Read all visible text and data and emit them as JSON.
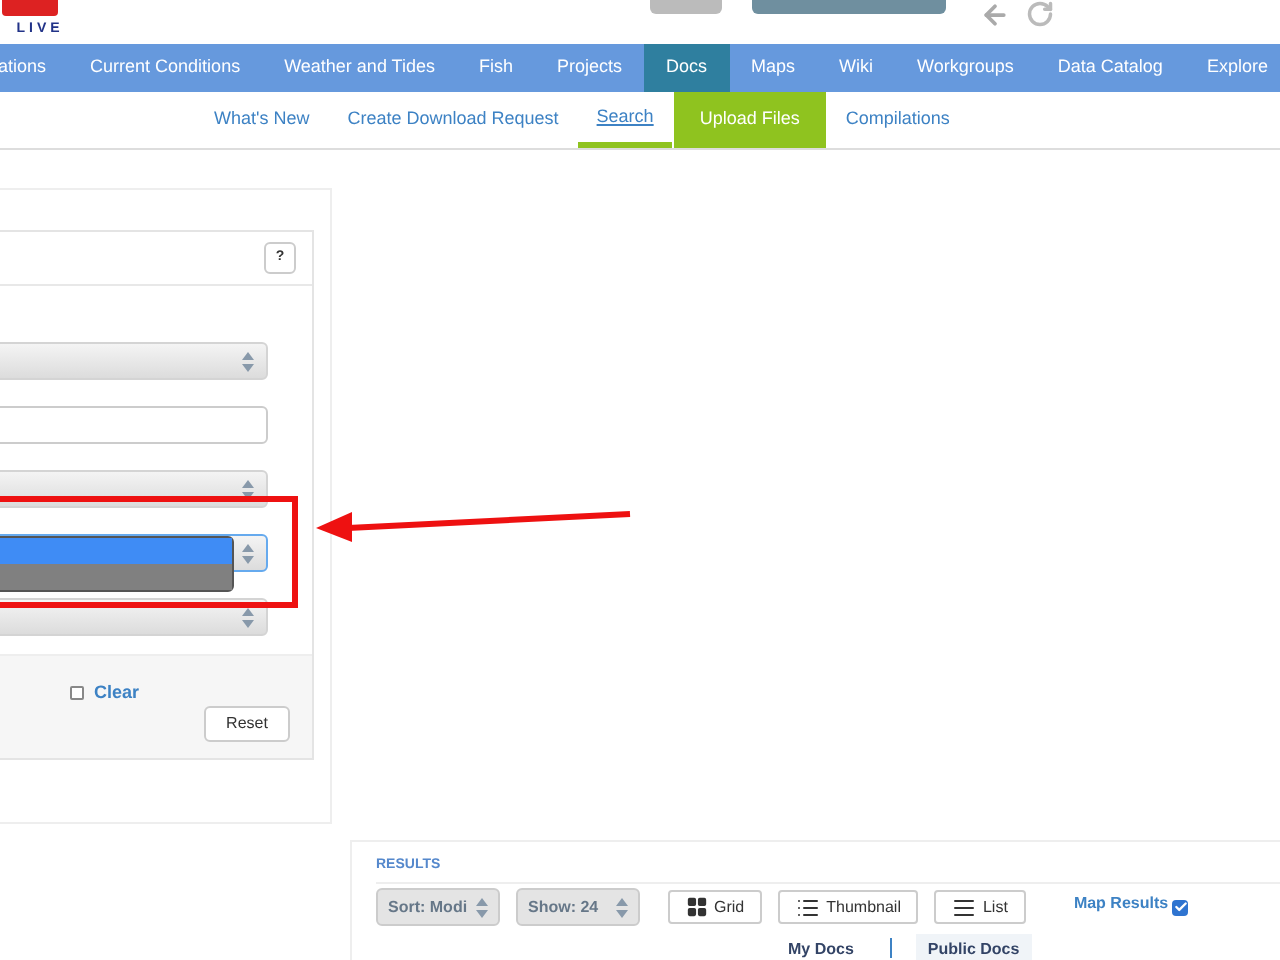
{
  "header": {
    "logo_text": "LIVE"
  },
  "nav": {
    "items": [
      {
        "label": "ations",
        "selected": false
      },
      {
        "label": "Current Conditions",
        "selected": false
      },
      {
        "label": "Weather and Tides",
        "selected": false
      },
      {
        "label": "Fish",
        "selected": false
      },
      {
        "label": "Projects",
        "selected": false
      },
      {
        "label": "Docs",
        "selected": true
      },
      {
        "label": "Maps",
        "selected": false
      },
      {
        "label": "Wiki",
        "selected": false
      },
      {
        "label": "Workgroups",
        "selected": false
      },
      {
        "label": "Data Catalog",
        "selected": false
      },
      {
        "label": "Explore",
        "selected": false
      }
    ]
  },
  "subnav": {
    "items": [
      {
        "label": "What's New",
        "selected": false,
        "kind": "link"
      },
      {
        "label": "Create Download Request",
        "selected": false,
        "kind": "link"
      },
      {
        "label": "Search",
        "selected": true,
        "kind": "link"
      },
      {
        "label": "Upload Files",
        "selected": false,
        "kind": "highlight"
      },
      {
        "label": "Compilations",
        "selected": false,
        "kind": "link"
      }
    ]
  },
  "search_panel": {
    "help": "?",
    "fields": [
      {
        "kind": "select",
        "open": false
      },
      {
        "kind": "input"
      },
      {
        "kind": "select",
        "open": false
      },
      {
        "kind": "select",
        "open": true,
        "options": [
          {
            "selected": true
          },
          {
            "selected": false
          }
        ]
      },
      {
        "kind": "select",
        "open": false
      }
    ],
    "clear": {
      "label": "Clear",
      "checked": false
    },
    "reset": "Reset"
  },
  "results": {
    "title": "RESULTS",
    "sort": "Sort: Modi",
    "show": "Show: 24",
    "views": [
      {
        "label": "Grid",
        "kind": "grid"
      },
      {
        "label": "Thumbnail",
        "kind": "thumbnail"
      },
      {
        "label": "List",
        "kind": "list"
      }
    ],
    "map_results": {
      "label": "Map Results",
      "checked": true
    },
    "tabs": [
      {
        "label": "My Docs",
        "selected": false
      },
      {
        "label": "Public Docs",
        "selected": true
      }
    ]
  }
}
